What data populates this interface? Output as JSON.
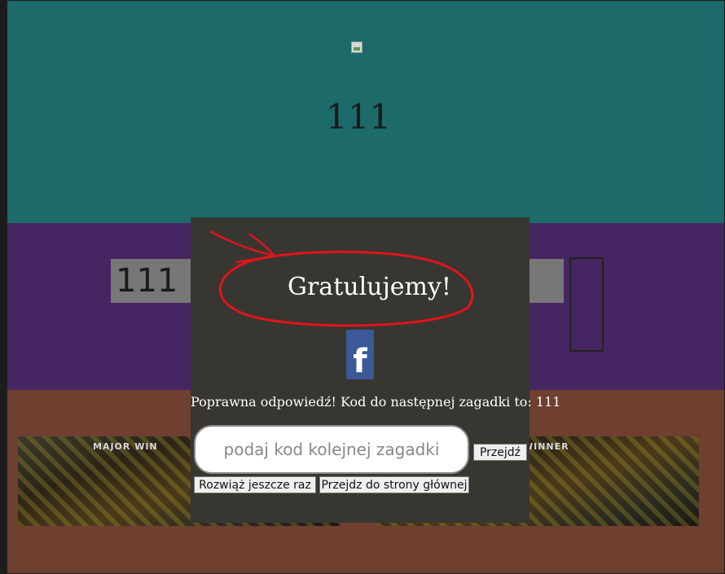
{
  "header": {
    "code": "111"
  },
  "answer": {
    "value": "111"
  },
  "modal": {
    "title": "Gratulujemy!",
    "facebook_icon": "facebook-icon",
    "result_text": "Poprawna odpowiedź! Kod do następnej zagadki to: 111",
    "next_code_placeholder": "podaj kod kolejnej zagadki",
    "go_button": "Przejdź",
    "retry_button": "Rozwiąż jeszcze raz",
    "home_button": "Przejdz do strony głównej"
  },
  "banners": {
    "left_caption": "MAJOR WIN",
    "right_caption": "WINNER"
  },
  "colors": {
    "top_band": "#1d6a6a",
    "middle_band": "#452662",
    "bottom_band": "#6f3f30",
    "modal_bg": "#383630",
    "annotation_red": "#e0141e",
    "facebook_blue": "#3b5998"
  }
}
